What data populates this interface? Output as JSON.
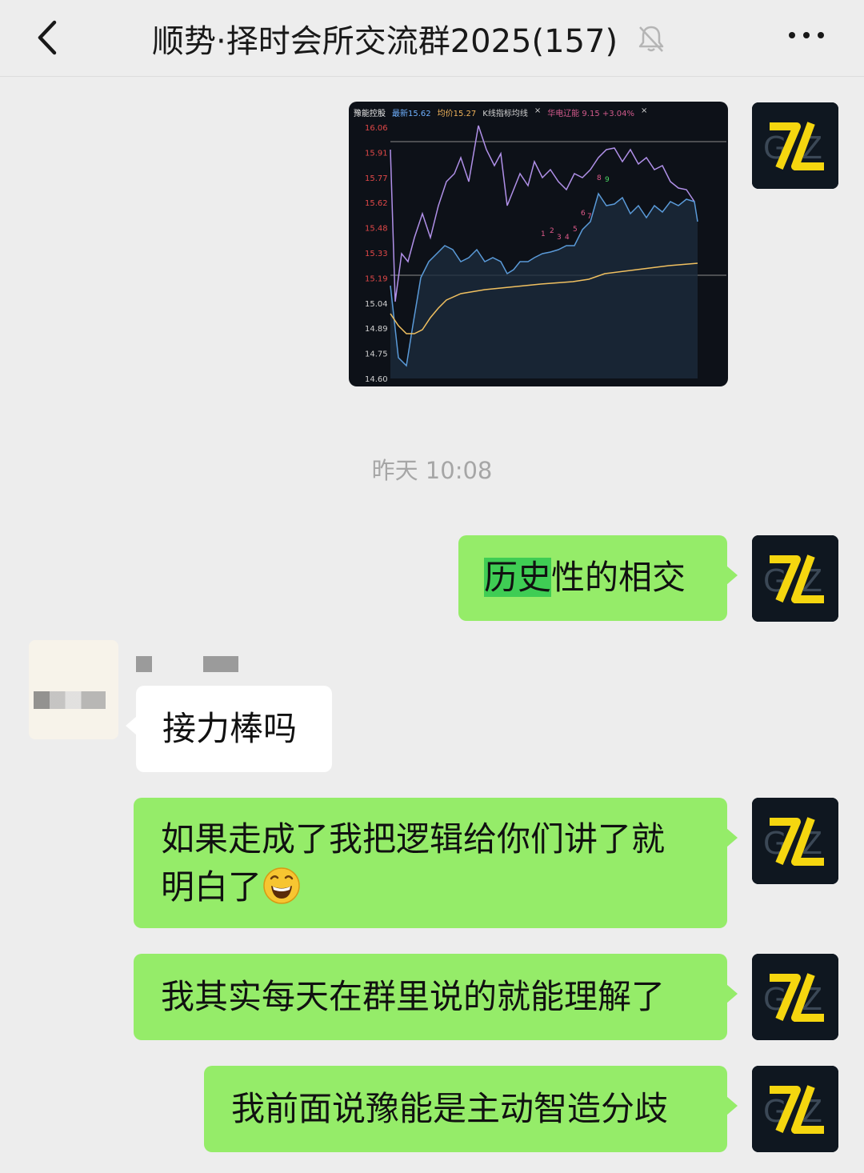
{
  "header": {
    "back_icon": "chevron-left-icon",
    "title": "顺势·择时会所交流群2025(157)",
    "mute_icon": "bell-off-icon",
    "more_icon": "more-dots-icon"
  },
  "image_message": {
    "chart_header": {
      "name": "豫能控股",
      "latest": "最新15.62",
      "avg": "均价15.27",
      "indicator": "K线指标均线",
      "close": "×",
      "compare": "华电辽能 9.15 +3.04%",
      "close2": "×"
    },
    "y_ticks": [
      "16.06",
      "15.91",
      "15.77",
      "15.62",
      "15.48",
      "15.33",
      "15.19",
      "15.04",
      "14.89",
      "14.75",
      "14.60"
    ],
    "markers": [
      "1",
      "2",
      "3",
      "4",
      "5",
      "6",
      "7",
      "8",
      "9"
    ]
  },
  "timestamp": "昨天 10:08",
  "messages": [
    {
      "pre_highlight": "",
      "highlight": "历史",
      "text": "性的相交"
    },
    {
      "sender": "blurred",
      "text": "接力棒吗"
    },
    {
      "line1": "如果走成了我把逻辑给你们讲了就",
      "line2": "明白了",
      "emoji": "grinning-face-emoji"
    },
    {
      "text": "我其实每天在群里说的就能理解了"
    },
    {
      "text": "我前面说豫能是主动智造分歧"
    }
  ],
  "avatar": {
    "brand_text": "GZ",
    "accent": "#f5d60f",
    "bg": "#0f1720"
  },
  "colors": {
    "bubble_green": "#95ec69",
    "highlight": "#3fcd54",
    "bg": "#ededed"
  }
}
